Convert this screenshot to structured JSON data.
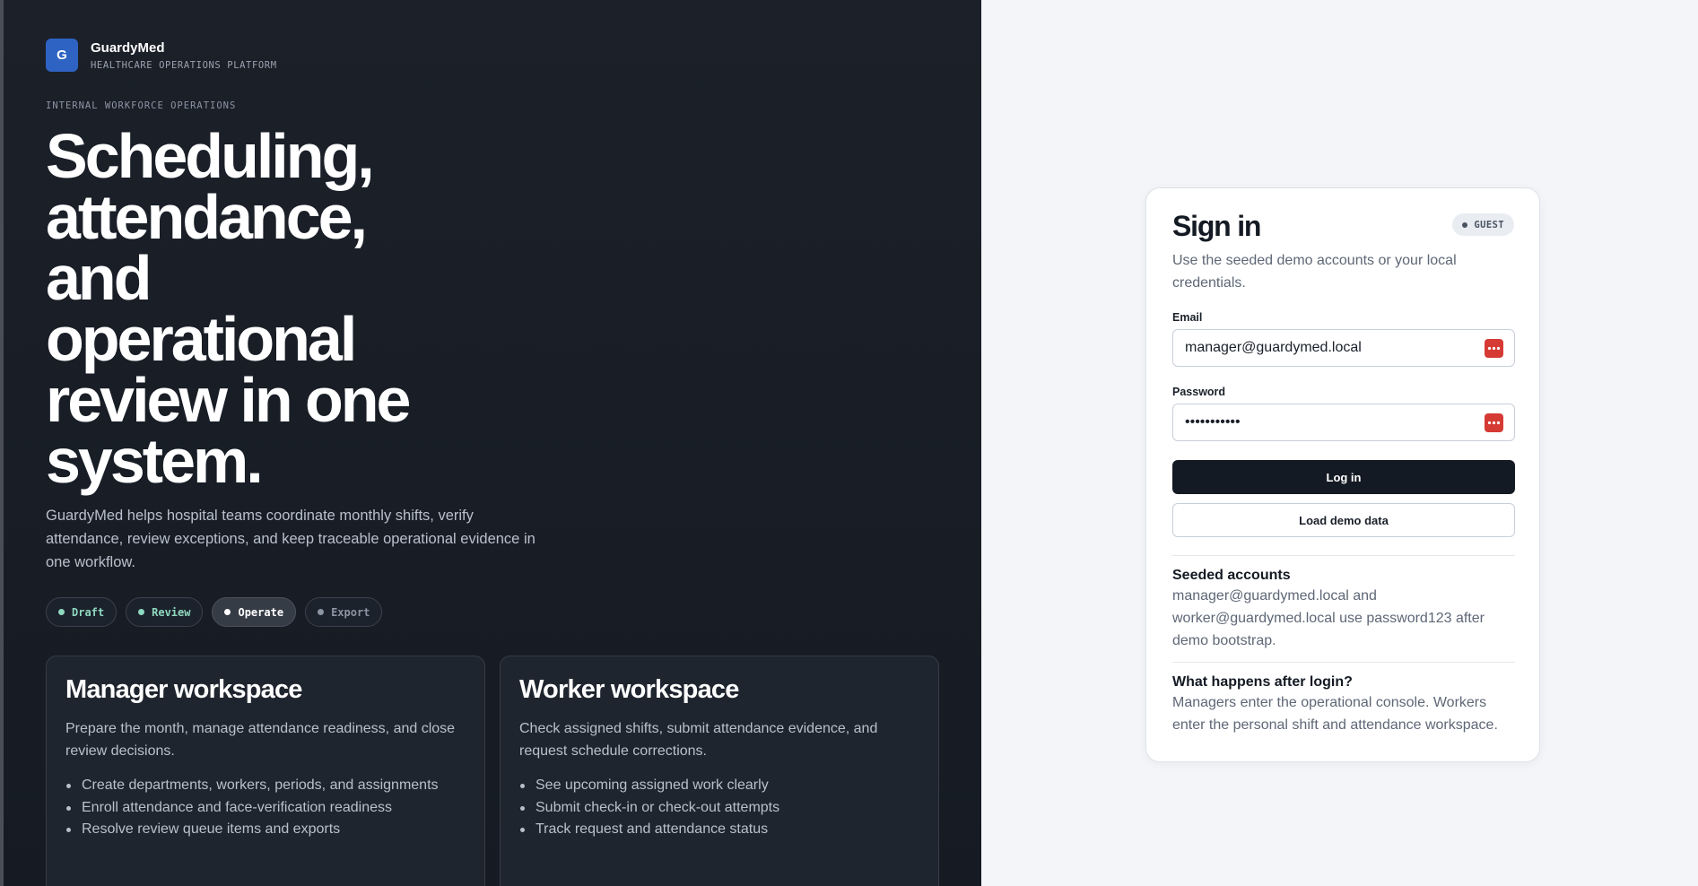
{
  "brand": {
    "logo_letter": "G",
    "name": "GuardyMed",
    "tagline": "HEALTHCARE OPERATIONS PLATFORM"
  },
  "hero": {
    "eyebrow": "INTERNAL WORKFORCE OPERATIONS",
    "headline_lines": [
      "Scheduling,",
      "attendance,",
      "and",
      "operational",
      "review in one",
      "system."
    ],
    "lead": "GuardyMed helps hospital teams coordinate monthly shifts, verify attendance, review exceptions, and keep traceable operational evidence in one workflow.",
    "chips": [
      {
        "label": "Draft",
        "state": "default"
      },
      {
        "label": "Review",
        "state": "default"
      },
      {
        "label": "Operate",
        "state": "active"
      },
      {
        "label": "Export",
        "state": "muted"
      }
    ]
  },
  "workspaces": [
    {
      "title": "Manager workspace",
      "description": "Prepare the month, manage attendance readiness, and close review decisions.",
      "items": [
        "Create departments, workers, periods, and assignments",
        "Enroll attendance and face-verification readiness",
        "Resolve review queue items and exports"
      ]
    },
    {
      "title": "Worker workspace",
      "description": "Check assigned shifts, submit attendance evidence, and request schedule corrections.",
      "items": [
        "See upcoming assigned work clearly",
        "Submit check-in or check-out attempts",
        "Track request and attendance status"
      ]
    }
  ],
  "signin": {
    "title": "Sign in",
    "badge": "GUEST",
    "subtitle": "Use the seeded demo accounts or your local credentials.",
    "email_label": "Email",
    "email_value": "manager@guardymed.local",
    "password_label": "Password",
    "password_value": "•••••••••••",
    "login_button": "Log in",
    "demo_button": "Load demo data",
    "seeded_title": "Seeded accounts",
    "seeded_text": "manager@guardymed.local and worker@guardymed.local use password123 after demo bootstrap.",
    "after_title": "What happens after login?",
    "after_text": "Managers enter the operational console. Workers enter the personal shift and attendance workspace."
  },
  "colors": {
    "hero_bg": "#1b2029",
    "brand_blue": "#2e63c4",
    "chip_accent": "#8fd8c0",
    "primary_button": "#141a23",
    "password_manager_icon": "#d63a34",
    "page_bg": "#f3f5f8"
  },
  "icons": {
    "password_manager": "password-manager-key-icon",
    "chip_dot": "status-dot-icon"
  }
}
